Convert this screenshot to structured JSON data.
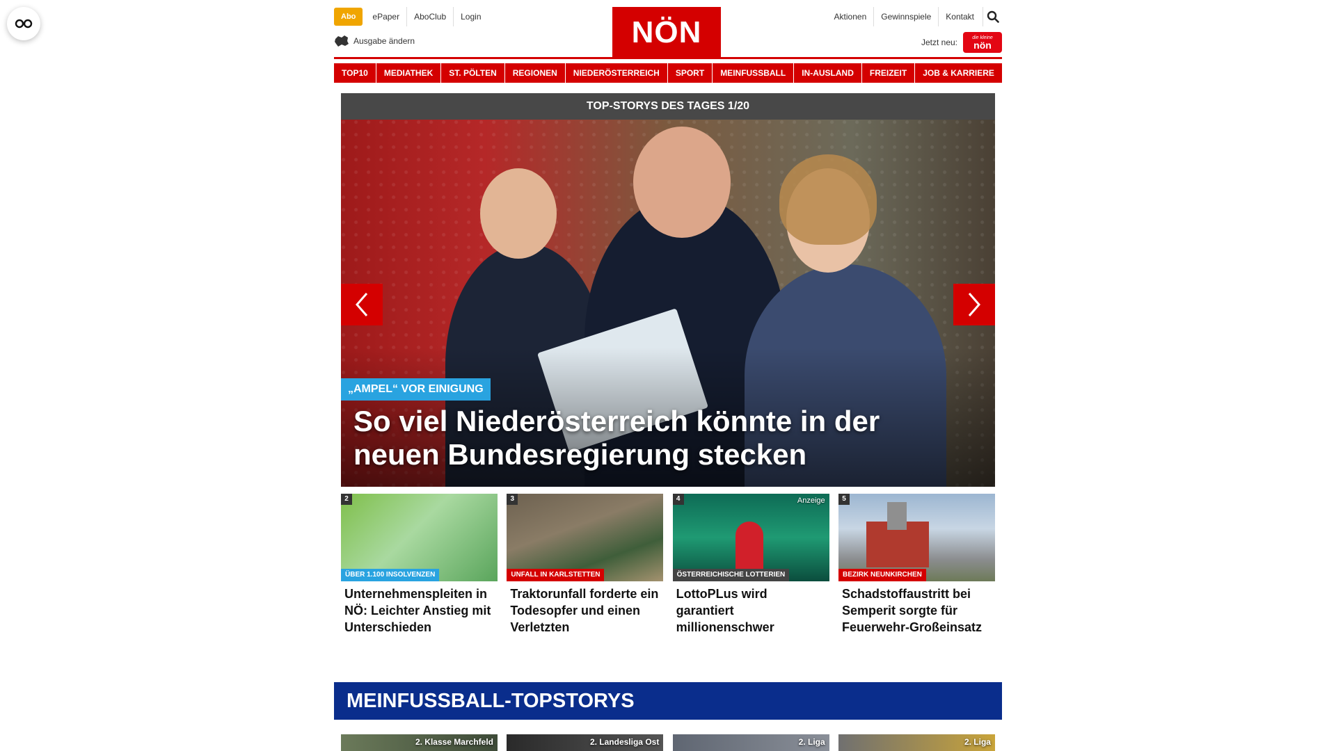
{
  "header": {
    "abo": "Abo",
    "top_links": [
      "ePaper",
      "AboClub",
      "Login"
    ],
    "edition": "Ausgabe ändern",
    "logo": "NÖN",
    "right_links": [
      "Aktionen",
      "Gewinnspiele",
      "Kontakt"
    ],
    "jetzt_neu": "Jetzt neu:",
    "badge_small": "die kleine",
    "badge_big": "nön"
  },
  "nav": [
    "TOP10",
    "MEDIATHEK",
    "ST. PÖLTEN",
    "REGIONEN",
    "NIEDERÖSTERREICH",
    "SPORT",
    "MEINFUSSBALL",
    "IN-AUSLAND",
    "FREIZEIT",
    "JOB & KARRIERE"
  ],
  "topstories": {
    "header": "TOP-STORYS DES TAGES 1/20",
    "hero": {
      "tag": "„AMPEL“ VOR EINIGUNG",
      "title": "So viel Niederösterreich könnte in der neuen Bundesregierung stecken"
    },
    "cards": [
      {
        "num": "2",
        "kicker": "ÜBER 1.100 INSOLVENZEN",
        "kicker_color": "#29a3e0",
        "title": "Unternehmenspleiten in NÖ: Leichter Anstieg mit Unterschieden",
        "ad": ""
      },
      {
        "num": "3",
        "kicker": "UNFALL IN KARLSTETTEN",
        "kicker_color": "#d40000",
        "title": "Traktorunfall forderte ein Todesopfer und einen Verletzten",
        "ad": ""
      },
      {
        "num": "4",
        "kicker": "ÖSTERREICHISCHE LOTTERIEN",
        "kicker_color": "#444444",
        "title": "LottoPLus wird garantiert millionenschwer",
        "ad": "Anzeige"
      },
      {
        "num": "5",
        "kicker": "BEZIRK NEUNKIRCHEN",
        "kicker_color": "#d40000",
        "title": "Schadstoffaustritt bei Semperit sorgte für Feuerwehr-Großeinsatz",
        "ad": ""
      }
    ]
  },
  "meinfussball": {
    "header": "MEINFUSSBALL-TOPSTORYS",
    "cards": [
      "2. Klasse Marchfeld",
      "2. Landesliga Ost",
      "2. Liga",
      "2. Liga"
    ]
  },
  "colors": {
    "brand_red": "#d40000",
    "abo_orange": "#f0a500",
    "mf_blue": "#0a2d8c"
  }
}
